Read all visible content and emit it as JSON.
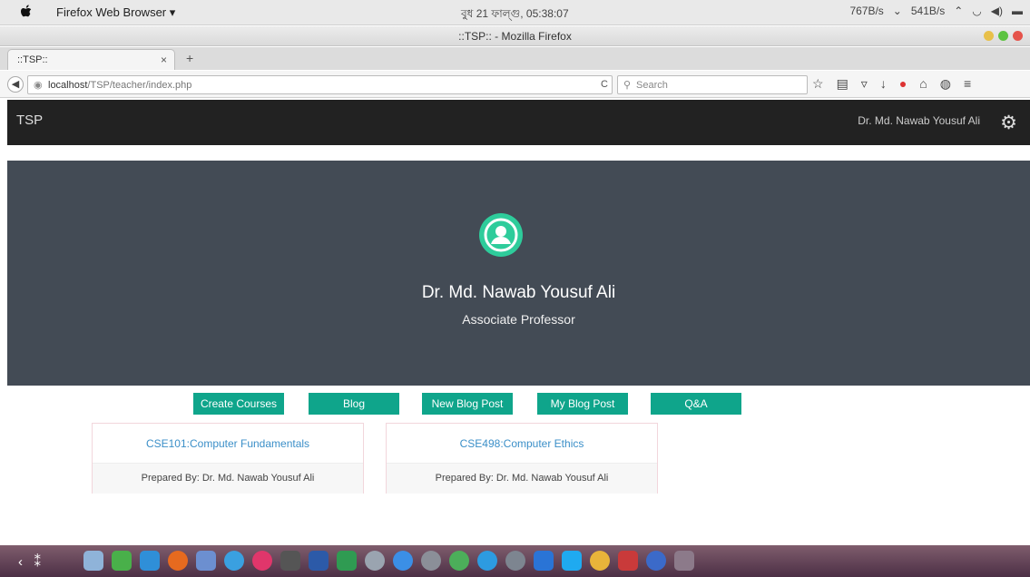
{
  "os_bar": {
    "app_menu": "Firefox Web Browser ▾",
    "clock": "বুধ 21 ফাল্গু, 05:38:07",
    "tray": [
      "767B/s",
      "541B/s"
    ]
  },
  "window": {
    "title": "::TSP:: - Mozilla Firefox"
  },
  "tab": {
    "label": "::TSP::",
    "close": "×",
    "new_tab": "+"
  },
  "toolbar": {
    "url_host": "localhost",
    "url_path": "/TSP/teacher/index.php",
    "search_placeholder": "Search",
    "reload": "C"
  },
  "site": {
    "brand": "TSP",
    "user": "Dr. Md. Nawab Yousuf Ali",
    "profile_name": "Dr. Md. Nawab Yousuf Ali",
    "profile_role": "Associate Professor"
  },
  "actions": [
    "Create Courses",
    "Blog",
    "New Blog Post",
    "My Blog Post",
    "Q&A"
  ],
  "courses": [
    {
      "title": "CSE101:Computer Fundamentals",
      "footer": "Prepared By: Dr. Md. Nawab Yousuf Ali"
    },
    {
      "title": "CSE498:Computer Ethics",
      "footer": "Prepared By: Dr. Md. Nawab Yousuf Ali"
    }
  ],
  "colors": {
    "accent": "#0fa58b",
    "hero_bg": "#434b55",
    "nav_bg": "#222222",
    "avatar": "#2ecc9b",
    "link": "#3b8fc8"
  },
  "dock_apps": [
    "launcher-icon",
    "firefox-icon",
    "preview-icon",
    "finder-icon",
    "itunes-icon",
    "photo-icon",
    "word-icon",
    "excel-icon",
    "utility-icon",
    "appstore-icon",
    "settings-icon",
    "map-icon",
    "messenger-icon",
    "sync-icon",
    "bluetooth-icon",
    "skype-icon",
    "chrome-icon",
    "flashcard-icon",
    "misc-icon",
    "grid-icon"
  ]
}
